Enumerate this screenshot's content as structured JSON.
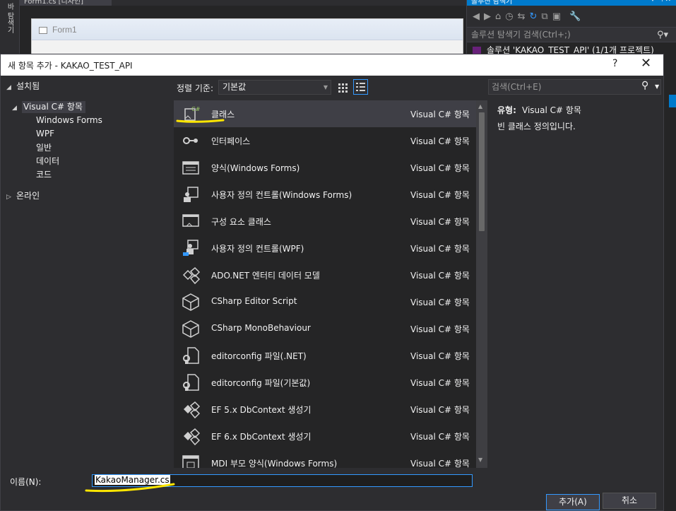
{
  "ide": {
    "left_tab_text": "바 탐색기",
    "left_tab_text2": "데",
    "doc_tab": "Form1.cs [디자인]",
    "form_title": "Form1",
    "solution_explorer": {
      "title": "솔루션 탐색기",
      "search_placeholder": "솔루션 탐색기 검색(Ctrl+;)",
      "root_item": "솔루션 'KAKAO_TEST_API' (1/1개 프로젝트)"
    }
  },
  "dialog": {
    "title": "새 항목 추가 - KAKAO_TEST_API",
    "help_label": "?",
    "close_label": "✕",
    "tree": {
      "installed": "설치됨",
      "visual_csharp": "Visual C# 항목",
      "children": [
        "Windows Forms",
        "WPF",
        "일반",
        "데이터",
        "코드"
      ],
      "online": "온라인"
    },
    "sort_label": "정렬 기준:",
    "sort_value": "기본값",
    "search_placeholder": "검색(Ctrl+E)",
    "items": [
      {
        "name": "클래스",
        "type": "Visual C# 항목",
        "icon": "class-icon"
      },
      {
        "name": "인터페이스",
        "type": "Visual C# 항목",
        "icon": "interface-icon"
      },
      {
        "name": "양식(Windows Forms)",
        "type": "Visual C# 항목",
        "icon": "form-icon"
      },
      {
        "name": "사용자 정의 컨트롤(Windows Forms)",
        "type": "Visual C# 항목",
        "icon": "user-control-icon"
      },
      {
        "name": "구성 요소 클래스",
        "type": "Visual C# 항목",
        "icon": "component-class-icon"
      },
      {
        "name": "사용자 정의 컨트롤(WPF)",
        "type": "Visual C# 항목",
        "icon": "wpf-user-control-icon"
      },
      {
        "name": "ADO.NET 엔터티 데이터 모델",
        "type": "Visual C# 항목",
        "icon": "entity-model-icon"
      },
      {
        "name": "CSharp Editor Script",
        "type": "Visual C# 항목",
        "icon": "unity-cube-icon"
      },
      {
        "name": "CSharp MonoBehaviour",
        "type": "Visual C# 항목",
        "icon": "unity-cube-icon"
      },
      {
        "name": "editorconfig 파일(.NET)",
        "type": "Visual C# 항목",
        "icon": "config-file-icon"
      },
      {
        "name": "editorconfig 파일(기본값)",
        "type": "Visual C# 항목",
        "icon": "config-file-icon"
      },
      {
        "name": "EF 5.x DbContext 생성기",
        "type": "Visual C# 항목",
        "icon": "dbcontext-icon"
      },
      {
        "name": "EF 6.x DbContext 생성기",
        "type": "Visual C# 항목",
        "icon": "dbcontext-icon"
      },
      {
        "name": "MDI 부모 양식(Windows Forms)",
        "type": "Visual C# 항목",
        "icon": "mdi-form-icon"
      }
    ],
    "details": {
      "type_label": "유형:",
      "type_value": "Visual C# 항목",
      "description": "빈 클래스 정의입니다."
    },
    "name_label": "이름(N):",
    "name_value": "KakaoManager.cs",
    "add_button": "추가(A)",
    "cancel_button": "취소"
  },
  "colors": {
    "accent": "#007acc",
    "highlight_underline": "#ffe600",
    "selection_border": "#3399ff"
  }
}
